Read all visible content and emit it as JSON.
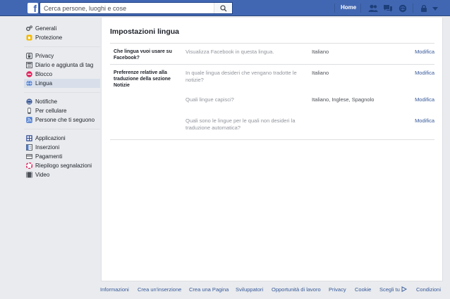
{
  "topbar": {
    "logo_letter": "f",
    "search_placeholder": "Cerca persone, luoghi e cose",
    "home_label": "Home",
    "icons": [
      "friend-requests-icon",
      "messages-icon",
      "notifications-icon",
      "privacy-shortcuts-icon",
      "account-menu-icon"
    ],
    "colors": {
      "bar": "#4267b2",
      "bar_border": "#29487d"
    }
  },
  "sidebar": {
    "groups": [
      [
        {
          "label": "Generali",
          "icon": "gear-icon"
        },
        {
          "label": "Protezione",
          "icon": "shield-icon"
        }
      ],
      [
        {
          "label": "Privacy",
          "icon": "lock-icon"
        },
        {
          "label": "Diario e aggiunta di tag",
          "icon": "timeline-icon"
        },
        {
          "label": "Blocco",
          "icon": "block-icon"
        },
        {
          "label": "Lingua",
          "icon": "globe-icon",
          "active": true
        }
      ],
      [
        {
          "label": "Notifiche",
          "icon": "notifications-globe-icon"
        },
        {
          "label": "Per cellulare",
          "icon": "mobile-icon"
        },
        {
          "label": "Persone che ti seguono",
          "icon": "rss-icon"
        }
      ],
      [
        {
          "label": "Applicazioni",
          "icon": "apps-icon"
        },
        {
          "label": "Inserzioni",
          "icon": "ads-icon"
        },
        {
          "label": "Pagamenti",
          "icon": "payments-icon"
        },
        {
          "label": "Riepilogo segnalazioni",
          "icon": "support-inbox-icon"
        },
        {
          "label": "Video",
          "icon": "video-icon"
        }
      ]
    ]
  },
  "main": {
    "title": "Impostazioni lingua",
    "rows": [
      {
        "label": "Che lingua vuoi usare su Facebook?",
        "items": [
          {
            "description": "Visualizza Facebook in questa lingua.",
            "value": "Italiano",
            "action": "Modifica"
          }
        ]
      },
      {
        "label": "Preferenze relative alla traduzione della sezione Notizie",
        "items": [
          {
            "description": "In quale lingua desideri che vengano tradotte le notizie?",
            "value": "Italiano",
            "action": "Modifica"
          },
          {
            "description": "Quali lingue capisci?",
            "value": "Italiano, Inglese, Spagnolo",
            "action": "Modifica"
          },
          {
            "description": "Quali sono le lingue per le quali non desideri la traduzione automatica?",
            "value": "",
            "action": "Modifica"
          }
        ]
      }
    ]
  },
  "footer": {
    "links": [
      "Informazioni",
      "Crea un'inserzione",
      "Crea una Pagina",
      "Sviluppatori",
      "Opportunità di lavoro",
      "Privacy",
      "Cookie",
      "Scegli tu",
      "Condizioni"
    ]
  }
}
